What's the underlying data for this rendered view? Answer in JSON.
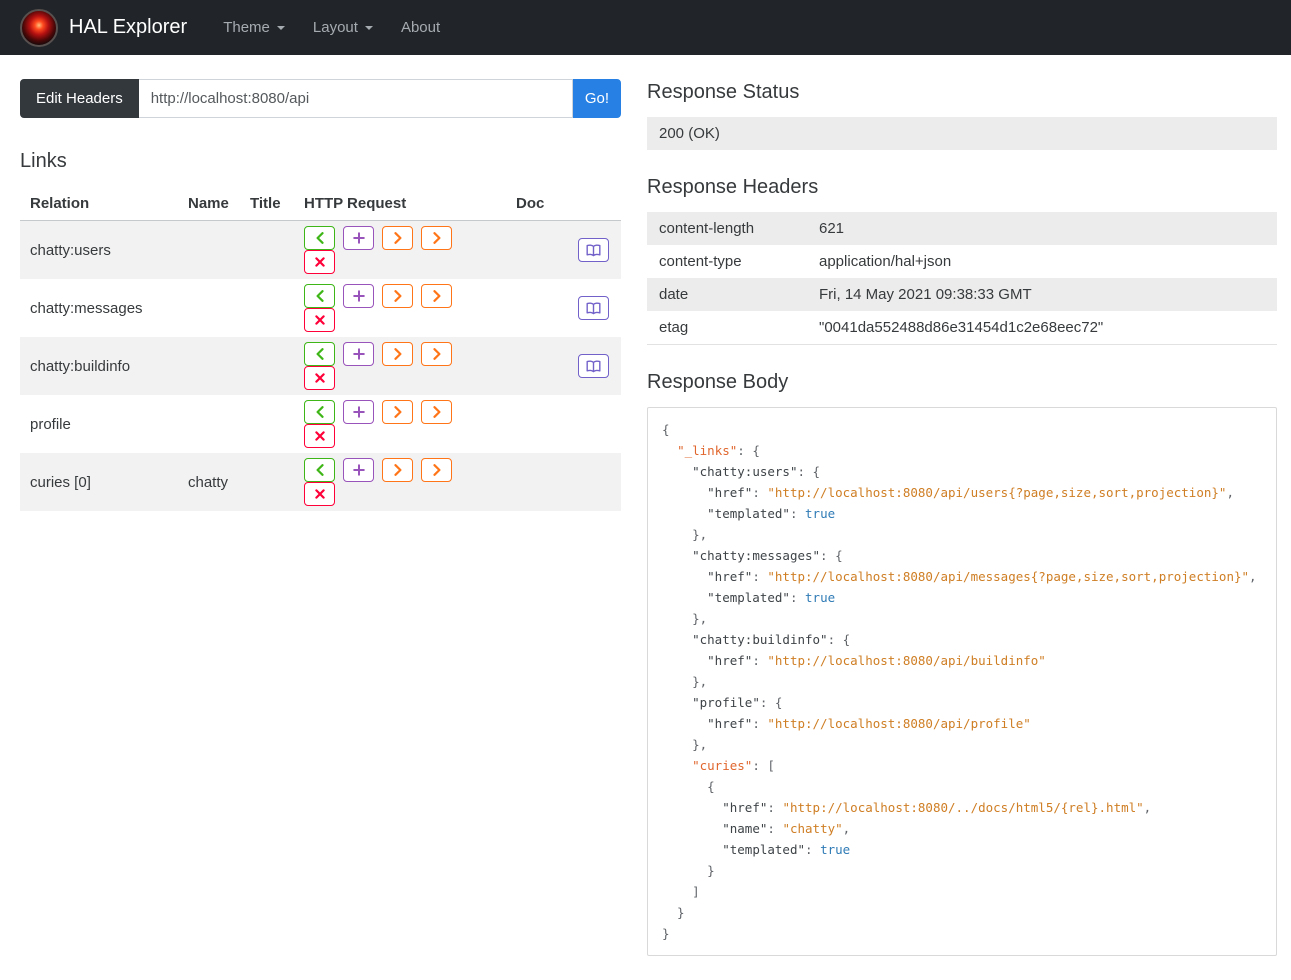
{
  "colors": {
    "accent_blue": "#2780e3",
    "get_green": "#3fb618",
    "post_purple": "#9954bb",
    "put_patch_orange": "#ff7518",
    "delete_red": "#ff0039",
    "doc_purple": "#7161c9",
    "navbar_dark": "#212529"
  },
  "navbar": {
    "brand": "HAL Explorer",
    "items": [
      {
        "label": "Theme",
        "dropdown": true
      },
      {
        "label": "Layout",
        "dropdown": true
      },
      {
        "label": "About",
        "dropdown": false
      }
    ]
  },
  "request_bar": {
    "edit_headers_label": "Edit Headers",
    "url_value": "http://localhost:8080/api",
    "go_label": "Go!"
  },
  "links_section": {
    "title": "Links",
    "columns": [
      "Relation",
      "Name",
      "Title",
      "HTTP Request",
      "Doc"
    ],
    "http_buttons": [
      {
        "method": "get",
        "icon": "chevron-left-icon",
        "color": "#3fb618"
      },
      {
        "method": "post",
        "icon": "plus-icon",
        "color": "#9954bb"
      },
      {
        "method": "put",
        "icon": "chevron-right-icon",
        "color": "#ff7518"
      },
      {
        "method": "patch",
        "icon": "chevron-right-icon",
        "color": "#ff7518"
      },
      {
        "method": "delete",
        "icon": "cross-icon",
        "color": "#ff0039"
      }
    ],
    "doc_button": {
      "icon": "book-icon",
      "color": "#7161c9"
    },
    "rows": [
      {
        "relation": "chatty:users",
        "name": "",
        "title": "",
        "doc": true
      },
      {
        "relation": "chatty:messages",
        "name": "",
        "title": "",
        "doc": true
      },
      {
        "relation": "chatty:buildinfo",
        "name": "",
        "title": "",
        "doc": true
      },
      {
        "relation": "profile",
        "name": "",
        "title": "",
        "doc": false
      },
      {
        "relation": "curies [0]",
        "name": "chatty",
        "title": "",
        "doc": false
      }
    ]
  },
  "response": {
    "status_title": "Response Status",
    "status_value": "200 (OK)",
    "headers_title": "Response Headers",
    "headers": [
      {
        "name": "content-length",
        "value": "621"
      },
      {
        "name": "content-type",
        "value": "application/hal+json"
      },
      {
        "name": "date",
        "value": "Fri, 14 May 2021 09:38:33 GMT"
      },
      {
        "name": "etag",
        "value": "\"0041da552488d86e31454d1c2e68eec72\""
      }
    ],
    "body_title": "Response Body",
    "body_lines": [
      [
        [
          "p",
          "{"
        ]
      ],
      [
        [
          "p",
          "  "
        ],
        [
          "o",
          "\"_links\""
        ],
        [
          "p",
          ": {"
        ]
      ],
      [
        [
          "p",
          "    "
        ],
        [
          "k",
          "\"chatty:users\""
        ],
        [
          "p",
          ": {"
        ]
      ],
      [
        [
          "p",
          "      "
        ],
        [
          "k",
          "\"href\""
        ],
        [
          "p",
          ": "
        ],
        [
          "s",
          "\"http://localhost:8080/api/users{?page,size,sort,projection}\""
        ],
        [
          "p",
          ","
        ]
      ],
      [
        [
          "p",
          "      "
        ],
        [
          "k",
          "\"templated\""
        ],
        [
          "p",
          ": "
        ],
        [
          "b",
          "true"
        ]
      ],
      [
        [
          "p",
          "    },"
        ]
      ],
      [
        [
          "p",
          "    "
        ],
        [
          "k",
          "\"chatty:messages\""
        ],
        [
          "p",
          ": {"
        ]
      ],
      [
        [
          "p",
          "      "
        ],
        [
          "k",
          "\"href\""
        ],
        [
          "p",
          ": "
        ],
        [
          "s",
          "\"http://localhost:8080/api/messages{?page,size,sort,projection}\""
        ],
        [
          "p",
          ","
        ]
      ],
      [
        [
          "p",
          "      "
        ],
        [
          "k",
          "\"templated\""
        ],
        [
          "p",
          ": "
        ],
        [
          "b",
          "true"
        ]
      ],
      [
        [
          "p",
          "    },"
        ]
      ],
      [
        [
          "p",
          "    "
        ],
        [
          "k",
          "\"chatty:buildinfo\""
        ],
        [
          "p",
          ": {"
        ]
      ],
      [
        [
          "p",
          "      "
        ],
        [
          "k",
          "\"href\""
        ],
        [
          "p",
          ": "
        ],
        [
          "s",
          "\"http://localhost:8080/api/buildinfo\""
        ]
      ],
      [
        [
          "p",
          "    },"
        ]
      ],
      [
        [
          "p",
          "    "
        ],
        [
          "k",
          "\"profile\""
        ],
        [
          "p",
          ": {"
        ]
      ],
      [
        [
          "p",
          "      "
        ],
        [
          "k",
          "\"href\""
        ],
        [
          "p",
          ": "
        ],
        [
          "s",
          "\"http://localhost:8080/api/profile\""
        ]
      ],
      [
        [
          "p",
          "    },"
        ]
      ],
      [
        [
          "p",
          "    "
        ],
        [
          "o",
          "\"curies\""
        ],
        [
          "p",
          ": ["
        ]
      ],
      [
        [
          "p",
          "      {"
        ]
      ],
      [
        [
          "p",
          "        "
        ],
        [
          "k",
          "\"href\""
        ],
        [
          "p",
          ": "
        ],
        [
          "s",
          "\"http://localhost:8080/../docs/html5/{rel}.html\""
        ],
        [
          "p",
          ","
        ]
      ],
      [
        [
          "p",
          "        "
        ],
        [
          "k",
          "\"name\""
        ],
        [
          "p",
          ": "
        ],
        [
          "s",
          "\"chatty\""
        ],
        [
          "p",
          ","
        ]
      ],
      [
        [
          "p",
          "        "
        ],
        [
          "k",
          "\"templated\""
        ],
        [
          "p",
          ": "
        ],
        [
          "b",
          "true"
        ]
      ],
      [
        [
          "p",
          "      }"
        ]
      ],
      [
        [
          "p",
          "    ]"
        ]
      ],
      [
        [
          "p",
          "  }"
        ]
      ],
      [
        [
          "p",
          "}"
        ]
      ]
    ]
  }
}
